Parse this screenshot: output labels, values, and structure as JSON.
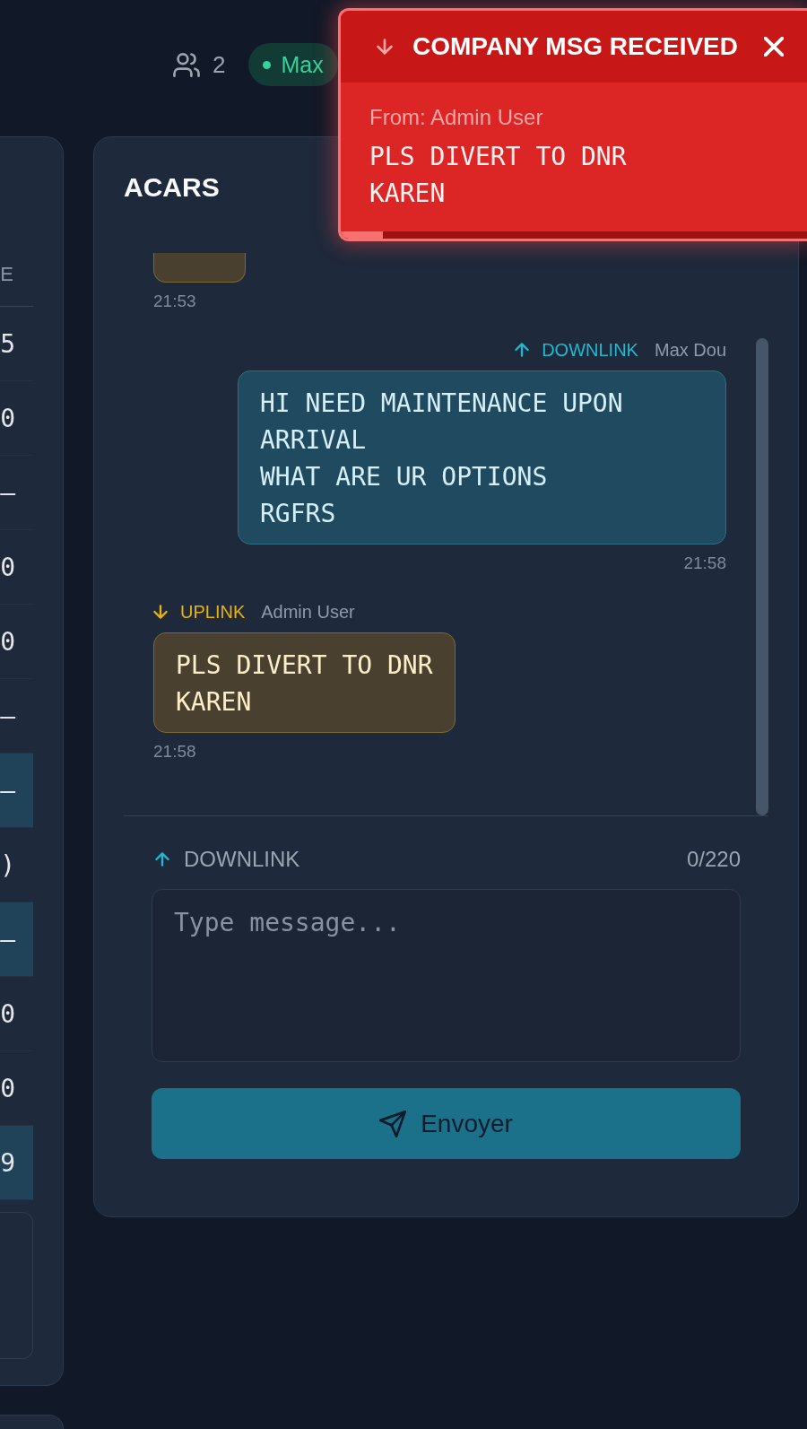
{
  "header": {
    "online_count": "2",
    "user_badge": {
      "label": "Max",
      "connected": true
    }
  },
  "side_panel": {
    "column_header": "E",
    "rows": [
      {
        "value": "5",
        "highlighted": false
      },
      {
        "value": "0",
        "highlighted": false
      },
      {
        "value": "—",
        "highlighted": false
      },
      {
        "value": "0",
        "highlighted": false
      },
      {
        "value": "0",
        "highlighted": false
      },
      {
        "value": "—",
        "highlighted": false
      },
      {
        "value": "—",
        "highlighted": true
      },
      {
        "value": ")",
        "highlighted": false
      },
      {
        "value": "—",
        "highlighted": true
      },
      {
        "value": "0",
        "highlighted": false
      },
      {
        "value": "0",
        "highlighted": false
      },
      {
        "value": "9",
        "highlighted": true
      }
    ]
  },
  "acars": {
    "title": "ACARS",
    "messages": [
      {
        "kind": "up",
        "clipped": true,
        "time": "21:53"
      },
      {
        "kind": "down",
        "clipped": false,
        "label": "DOWNLINK",
        "sender": "Max Dou",
        "text": "HI NEED MAINTENANCE UPON ARRIVAL\nWHAT ARE UR OPTIONS\nRGFRS",
        "time": "21:58"
      },
      {
        "kind": "up",
        "clipped": false,
        "label": "UPLINK",
        "sender": "Admin User",
        "text": "PLS DIVERT TO DNR\nKAREN",
        "time": "21:58"
      }
    ],
    "composer": {
      "kind": "down",
      "label": "DOWNLINK",
      "counter": "0/220",
      "placeholder": "Type message...",
      "send_label": "Envoyer"
    }
  },
  "toast": {
    "title": "COMPANY MSG RECEIVED",
    "sender": "From: Admin User",
    "text": "PLS DIVERT TO DNR\nKAREN",
    "progress": {
      "level": 0.09
    }
  }
}
